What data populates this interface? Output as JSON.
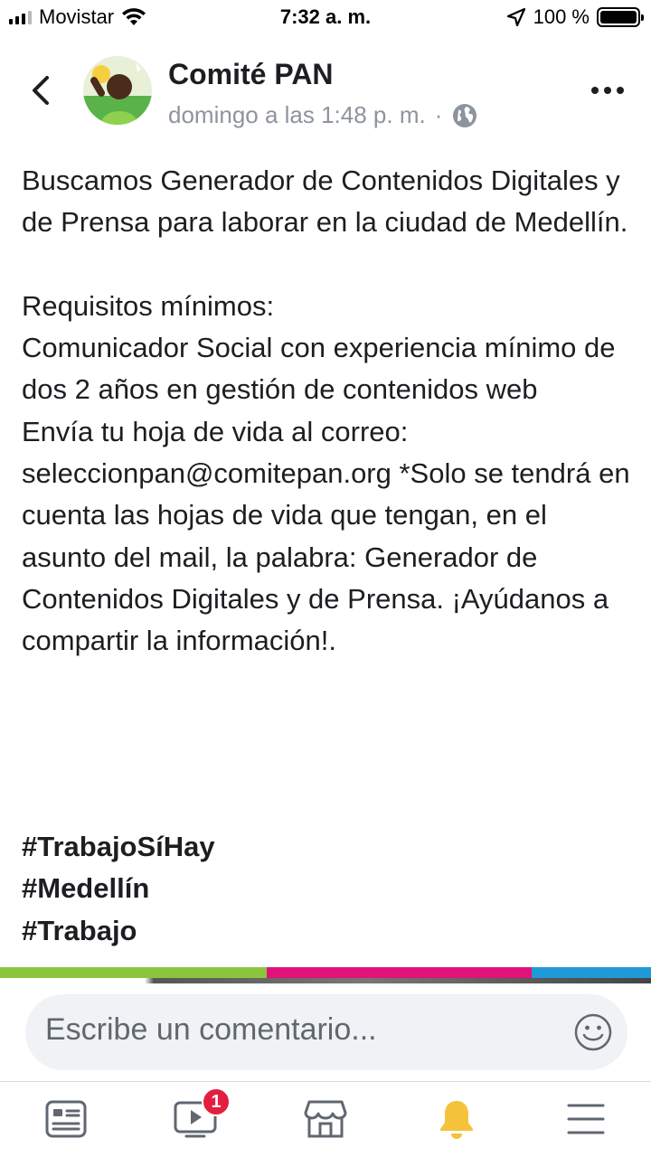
{
  "status_bar": {
    "carrier": "Movistar",
    "time": "7:32 a. m.",
    "battery": "100 %"
  },
  "header": {
    "author": "Comité PAN",
    "timestamp": "domingo a las 1:48 p. m.",
    "separator": "·",
    "privacy_icon": "globe-icon"
  },
  "post": {
    "body": "Buscamos Generador de Contenidos Digitales y de Prensa para laborar en la ciudad de Medellín.\n\nRequisitos mínimos:\nComunicador Social con experiencia mínimo de dos 2 años en gestión de contenidos web\nEnvía tu hoja de vida al correo: seleccionpan@comitepan.org *Solo se tendrá en cuenta las hojas de vida que tengan, en el asunto del mail, la palabra: Generador de Contenidos Digitales y de Prensa. ¡Ayúdanos a compartir la información!.",
    "hashtags": [
      "#TrabajoSíHay",
      "#Medellín",
      "#Trabajo"
    ]
  },
  "comment": {
    "placeholder": "Escribe un comentario..."
  },
  "tabbar": {
    "items": [
      {
        "name": "news-feed",
        "icon": "news-feed-icon"
      },
      {
        "name": "watch",
        "icon": "video-icon",
        "badge": "1"
      },
      {
        "name": "marketplace",
        "icon": "marketplace-icon"
      },
      {
        "name": "notifications",
        "icon": "bell-icon"
      },
      {
        "name": "menu",
        "icon": "hamburger-menu-icon"
      }
    ]
  },
  "colors": {
    "strip_green": "#8bc53f",
    "strip_pink": "#e1127a",
    "strip_blue": "#1f9ad6",
    "badge_red": "#e41e3f",
    "bell_yellow": "#f5c33b"
  }
}
